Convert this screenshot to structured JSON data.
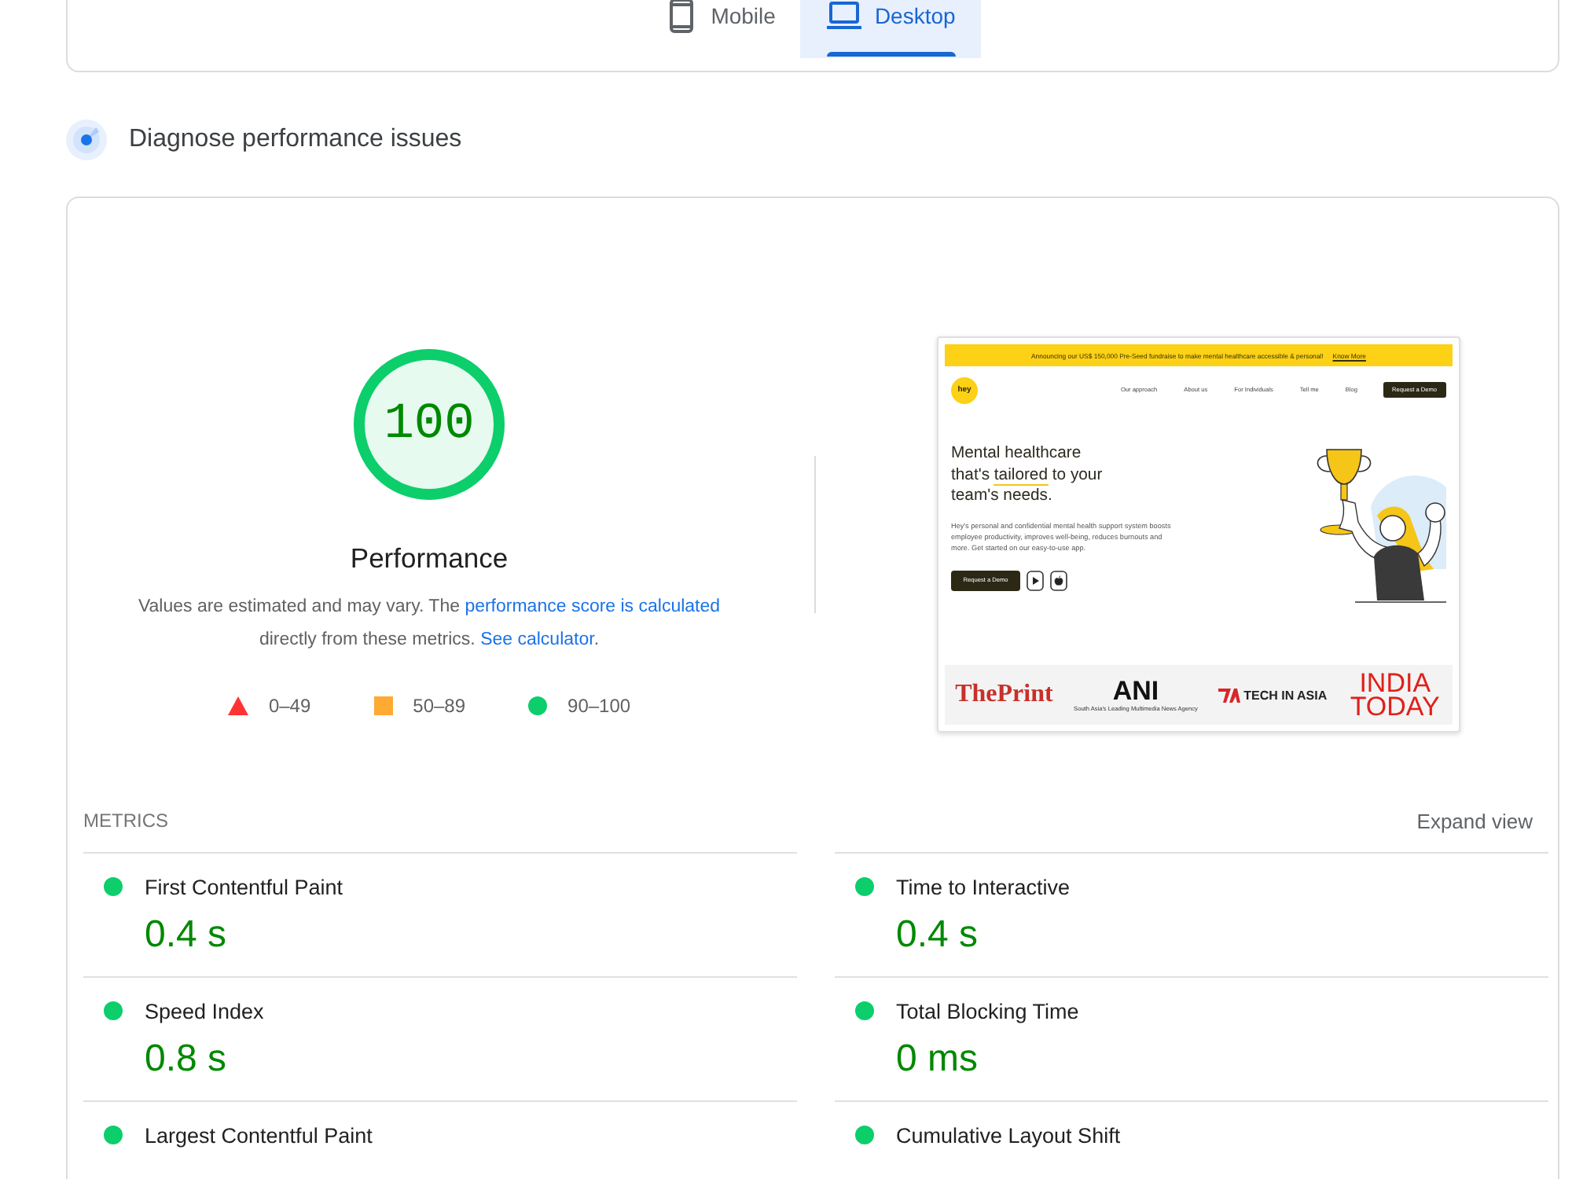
{
  "tabs": [
    {
      "kind": "phone",
      "label": "Mobile",
      "selected": false
    },
    {
      "kind": "laptop",
      "label": "Desktop",
      "selected": true
    }
  ],
  "diagnose": {
    "title": "Diagnose performance issues"
  },
  "score": {
    "value": "100",
    "level": 1,
    "label": "Performance"
  },
  "description": [
    {
      "kind": "text",
      "text": "Values are estimated and may vary. The "
    },
    {
      "kind": "link",
      "text": "performance score is calculated"
    },
    {
      "kind": "text",
      "text": " directly from these metrics. "
    },
    {
      "kind": "link",
      "text": "See calculator"
    },
    {
      "kind": "text",
      "text": "."
    }
  ],
  "legend": [
    {
      "kind": "triangle",
      "color": "#ff3333",
      "label": "0–49"
    },
    {
      "kind": "square",
      "color": "#ffaa33",
      "label": "50–89"
    },
    {
      "kind": "circle",
      "color": "#0cce6b",
      "label": "90–100"
    }
  ],
  "preview": {
    "banner": "Announcing our US$ 150,000 Pre-Seed fundraise to make mental healthcare accessible & personal!",
    "banner_link": "Know More",
    "logo": "hey",
    "nav": [
      "Our approach",
      "About us",
      "For Individuals",
      "Tell me",
      "Blog"
    ],
    "nav_button": "Request a Demo",
    "headline": [
      [
        {
          "text": "Mental healthcare",
          "underline": false
        }
      ],
      [
        {
          "text": "that's ",
          "underline": false
        },
        {
          "text": "tailored",
          "underline": true
        },
        {
          "text": " to your",
          "underline": false
        }
      ],
      [
        {
          "text": "team's needs.",
          "underline": false
        }
      ]
    ],
    "body": "Hey's personal and confidential mental health support system boosts employee productivity, improves well-being, reduces burnouts and more. Get started on our easy-to-use app.",
    "cta": "Request a Demo",
    "press": [
      {
        "kind": "serif",
        "text": "The**Print**"
      },
      {
        "kind": "caption",
        "text": "ANI",
        "caption": "South Asia's Leading Multimedia News Agency"
      },
      {
        "kind": "mark",
        "text": "TECH IN ASIA"
      },
      {
        "kind": "stacked",
        "text": "INDIA TODAY"
      }
    ]
  },
  "metrics": {
    "title": "METRICS",
    "expand": "Expand view",
    "items": [
      {
        "label": "First Contentful Paint",
        "value": "0.4 s",
        "color": "#0cce6b"
      },
      {
        "label": "Time to Interactive",
        "value": "0.4 s",
        "color": "#0cce6b"
      },
      {
        "label": "Speed Index",
        "value": "0.8 s",
        "color": "#0cce6b"
      },
      {
        "label": "Total Blocking Time",
        "value": "0 ms",
        "color": "#0cce6b"
      },
      {
        "label": "Largest Contentful Paint",
        "color": "#0cce6b"
      },
      {
        "label": "Cumulative Layout Shift",
        "color": "#0cce6b"
      }
    ]
  }
}
